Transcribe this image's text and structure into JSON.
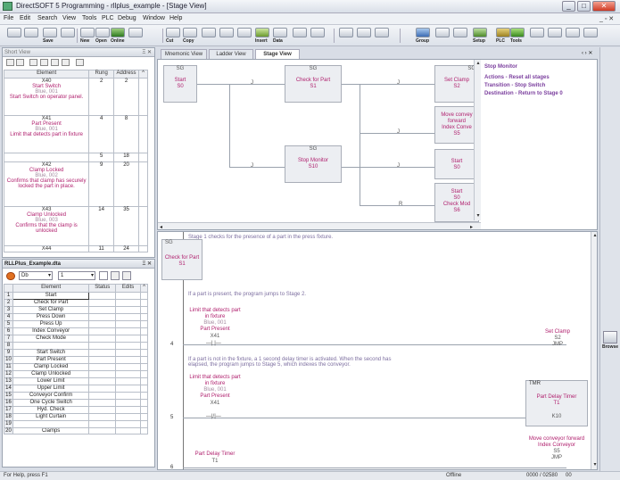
{
  "window": {
    "title": "DirectSOFT 5 Programming - rllplus_example - [Stage View]"
  },
  "menu": [
    "File",
    "Edit",
    "Search",
    "View",
    "Tools",
    "PLC",
    "Debug",
    "Window",
    "Help"
  ],
  "toolbar": {
    "save": "Save",
    "new": "New",
    "open": "Open",
    "online": "Online",
    "cut": "Cut",
    "copy": "Copy",
    "insert": "Insert",
    "data": "Data",
    "group": "Group",
    "setup": "Setup",
    "plc": "PLC",
    "tools": "Tools"
  },
  "left_top": {
    "title": "Short View",
    "headers": [
      "Element",
      "Rung",
      "Address"
    ],
    "rows": [
      {
        "name": "X40",
        "desc": "Start Switch",
        "nick": "Blue, 001",
        "doc": "Start Switch on operator panel.",
        "rung": "2",
        "addr": "2"
      },
      {
        "name": "X41",
        "desc": "Part Present",
        "nick": "Blue, 001",
        "doc": "Limit that detects part in fixture",
        "rung": "4",
        "addr": "8"
      },
      {
        "name": "",
        "desc": "",
        "nick": "",
        "doc": "",
        "rung": "5",
        "addr": "18"
      },
      {
        "name": "X42",
        "desc": "Clamp Locked",
        "nick": "Blue, 002",
        "doc": "Confirms that clamp has securely locked the part in place.",
        "rung": "9",
        "addr": "20"
      },
      {
        "name": "X43",
        "desc": "Clamp Unlocked",
        "nick": "Blue, 003",
        "doc": "Confirms that the clamp is unlocked",
        "rung": "14",
        "addr": "35"
      },
      {
        "name": "X44",
        "desc": "",
        "nick": "",
        "doc": "",
        "rung": "11",
        "addr": "24"
      }
    ]
  },
  "left_bottom": {
    "title": "RLLPlus_Example.dta",
    "filter1": "Db",
    "filter2": "1",
    "headers": [
      "Element",
      "Status",
      "Edits"
    ],
    "rows": [
      {
        "n": "1",
        "e": "Start"
      },
      {
        "n": "2",
        "e": "Check for Part"
      },
      {
        "n": "3",
        "e": "Set Clamp"
      },
      {
        "n": "4",
        "e": "Press Down"
      },
      {
        "n": "5",
        "e": "Press Up"
      },
      {
        "n": "6",
        "e": "Index Conveyor"
      },
      {
        "n": "7",
        "e": "Check Mode"
      },
      {
        "n": "8",
        "e": ""
      },
      {
        "n": "9",
        "e": "Start Switch"
      },
      {
        "n": "10",
        "e": "Part Present"
      },
      {
        "n": "11",
        "e": "Clamp Locked"
      },
      {
        "n": "12",
        "e": "Clamp Unlocked"
      },
      {
        "n": "13",
        "e": "Lower Limit"
      },
      {
        "n": "14",
        "e": "Upper Limit"
      },
      {
        "n": "15",
        "e": "Conveyor Confirm"
      },
      {
        "n": "16",
        "e": "One Cycle Switch"
      },
      {
        "n": "17",
        "e": "Hyd. Check"
      },
      {
        "n": "18",
        "e": "Light Curtain"
      },
      {
        "n": "19",
        "e": ""
      },
      {
        "n": "20",
        "e": "Clamps"
      }
    ]
  },
  "tabs": [
    "Mnemonic View",
    "Ladder View",
    "Stage View"
  ],
  "stage_view": {
    "s0": {
      "hdr": "SG",
      "l1": "Start",
      "l2": "S0"
    },
    "s1": {
      "hdr": "SG",
      "l1": "Check for Part",
      "l2": "S1"
    },
    "s2": {
      "hdr": "SG",
      "l1": "Set Clamp",
      "l2": "S2"
    },
    "s5": {
      "l1": "Move convey forward",
      "l2": "Index Conve",
      "l3": "S5"
    },
    "s10": {
      "hdr": "SG",
      "l1": "Stop Monitor",
      "l2": "S10"
    },
    "s0b": {
      "l1": "Start",
      "l2": "S0"
    },
    "s6": {
      "l1": "Start",
      "l2": "S0",
      "l3": "Check Mod",
      "l4": "S6"
    },
    "monitor_title": "Stop Monitor",
    "monitor_lines": [
      "Actions - Reset all stages",
      "Transition - Stop Switch",
      "Destination - Return to Stage 0"
    ],
    "jlbl": "J",
    "rlbl": "R"
  },
  "ladder": {
    "stage_hdr": "SG",
    "stage_l1": "Check for Part",
    "stage_l2": "S1",
    "cmt1": "Stage 1 checks for the presence of a part in the press fixture.",
    "cmt2": "If a part is present, the program jumps to Stage 2.",
    "r4_doc1": "Limit that detects part",
    "r4_doc2": "in fixture",
    "r4_nick": "Blue, 001",
    "r4_desc": "Part Present",
    "r4_addr": "X41",
    "r4_out1": "Set Clamp",
    "r4_out2": "S2",
    "r4_out3": "JMP",
    "r4_num": "4",
    "cmt3": "If a part is not in the fixture, a 1 second delay timer is activated. When the second has elapsed, the program jumps to Stage 5, which indexes the conveyor.",
    "r5_num": "5",
    "tmr_hdr": "TMR",
    "tmr_l1": "Part Delay Timer",
    "tmr_l2": "T1",
    "tmr_k": "K10",
    "r6_num": "6",
    "r6_desc": "Part Delay Timer",
    "r6_addr": "T1",
    "r6_out1": "Move conveyor forward",
    "r6_out2": "Index Conveyor",
    "r6_out3": "S5",
    "r6_out4": "JMP"
  },
  "status": {
    "help": "For Help, press F1",
    "mode": "Offline",
    "coords": "0000 / 02580",
    "rt": "00"
  },
  "sidebar_right": {
    "label": "Browse"
  }
}
